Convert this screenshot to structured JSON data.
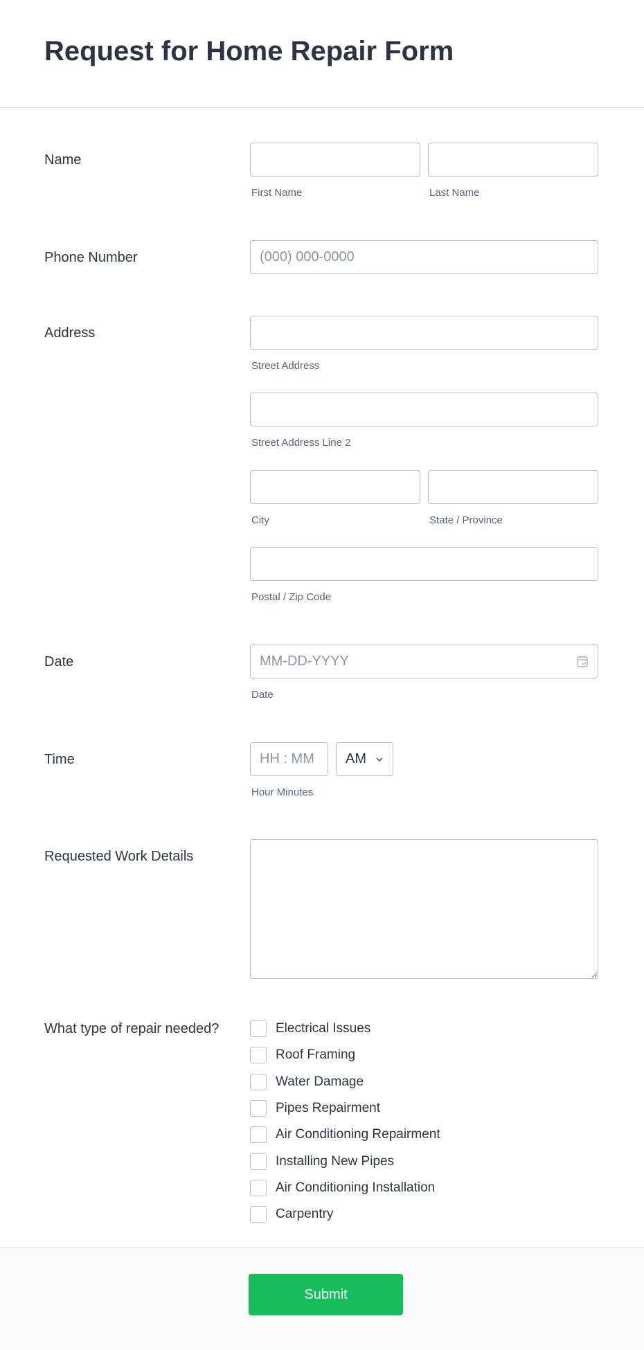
{
  "form": {
    "title": "Request for Home Repair Form",
    "name": {
      "label": "Name",
      "first_sub": "First Name",
      "last_sub": "Last Name",
      "first_value": "",
      "last_value": ""
    },
    "phone": {
      "label": "Phone Number",
      "placeholder": "(000) 000-0000"
    },
    "address": {
      "label": "Address",
      "street_sub": "Street Address",
      "line2_sub": "Street Address Line 2",
      "city_sub": "City",
      "state_sub": "State / Province",
      "zip_sub": "Postal / Zip Code"
    },
    "date": {
      "label": "Date",
      "placeholder": "MM-DD-YYYY",
      "sub": "Date",
      "icon": "calendar-icon"
    },
    "time": {
      "label": "Time",
      "placeholder": "HH : MM",
      "ampm": "AM",
      "sub": "Hour Minutes"
    },
    "details": {
      "label": "Requested Work Details"
    },
    "repair": {
      "label": "What type of repair needed?",
      "options": [
        "Electrical Issues",
        "Roof Framing",
        "Water Damage",
        "Pipes Repairment",
        "Air Conditioning Repairment",
        "Installing New Pipes",
        "Air Conditioning Installation",
        "Carpentry"
      ]
    },
    "submit_label": "Submit",
    "accent": "#18bd5b"
  }
}
